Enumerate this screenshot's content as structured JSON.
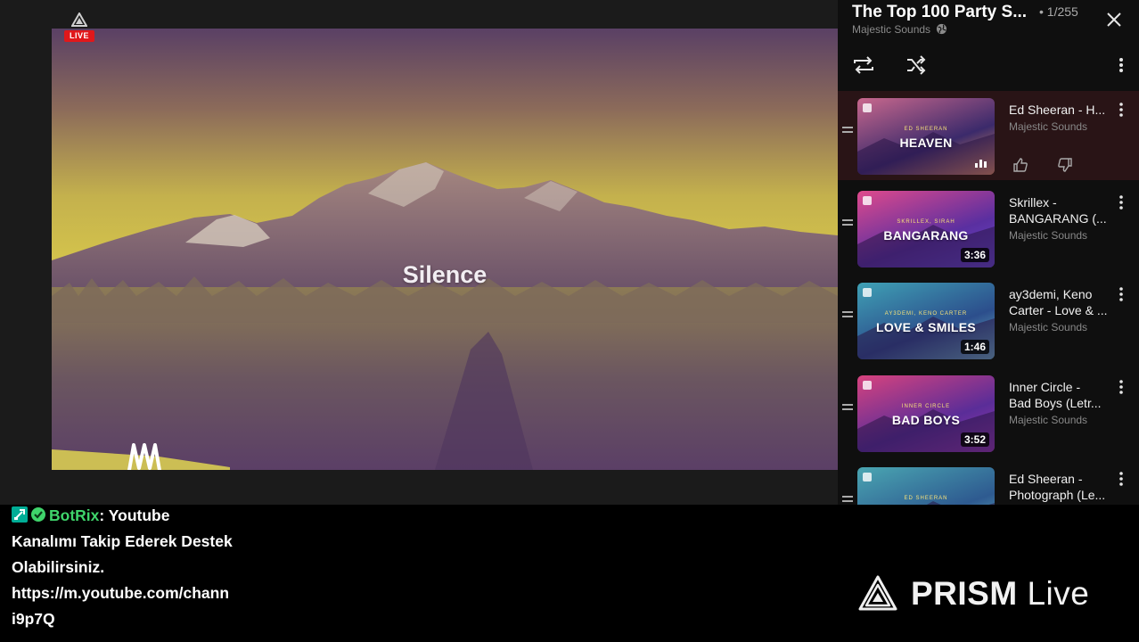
{
  "video": {
    "title": "Silence",
    "live_label": "LIVE"
  },
  "playlist": {
    "title": "The Top 100 Party S...",
    "position": "• 1/255",
    "channel": "Majestic Sounds",
    "items": [
      {
        "title_line1": "Ed Sheeran - H...",
        "title_line2": "",
        "channel": "Majestic Sounds",
        "thumb_title": "HEAVEN",
        "thumb_sub": "ED SHEERAN",
        "duration": "",
        "playing": true,
        "thumb_colors": [
          "#c9688d",
          "#3b2a6b",
          "#f29b57"
        ]
      },
      {
        "title_line1": "Skrillex -",
        "title_line2": "BANGARANG (...",
        "channel": "Majestic Sounds",
        "thumb_title": "BANGARANG",
        "thumb_sub": "SKRILLEX, SIRAH",
        "duration": "3:36",
        "playing": false,
        "thumb_colors": [
          "#e04a8c",
          "#5a2fa0",
          "#6b4ad0"
        ]
      },
      {
        "title_line1": "ay3demi, Keno",
        "title_line2": "Carter - Love & ...",
        "channel": "Majestic Sounds",
        "thumb_title": "LOVE & SMILES",
        "thumb_sub": "AY3DEMI, KENO CARTER",
        "duration": "1:46",
        "playing": false,
        "thumb_colors": [
          "#3fa1b5",
          "#2c4e8c",
          "#71c0c4"
        ]
      },
      {
        "title_line1": "Inner Circle -",
        "title_line2": "Bad Boys (Letr...",
        "channel": "Majestic Sounds",
        "thumb_title": "BAD BOYS",
        "thumb_sub": "INNER CIRCLE",
        "duration": "3:52",
        "playing": false,
        "thumb_colors": [
          "#d8437e",
          "#5a2d98",
          "#a03ab0"
        ]
      },
      {
        "title_line1": "Ed Sheeran -",
        "title_line2": "Photograph (Le...",
        "channel": "",
        "thumb_title": "",
        "thumb_sub": "ED SHEERAN",
        "duration": "",
        "playing": false,
        "thumb_colors": [
          "#4aa6b2",
          "#2e5a90",
          "#6ac4c6"
        ]
      }
    ]
  },
  "chat": {
    "username": "BotRix",
    "separator": ":",
    "message": "Youtube Kanalımı Takip Ederek Destek Olabilirsiniz. https://m.youtube.com/chann i9p7Q",
    "lines": [
      " Youtube",
      "Kanalımı Takip Ederek Destek",
      "Olabilirsiniz.",
      "https://m.youtube.com/chann",
      "i9p7Q"
    ],
    "colors": {
      "username": "#3fd46b",
      "text": "#ffffff"
    }
  },
  "branding": {
    "prism_bold": "PRISM",
    "prism_light": " Live"
  },
  "icons": {
    "live_triangle": "prism-triangle-icon",
    "globe": "globe-icon",
    "close": "close-icon",
    "loop": "loop-icon",
    "shuffle": "shuffle-icon",
    "menu": "more-vert-icon",
    "like": "thumbs-up-icon",
    "dislike": "thumbs-down-icon",
    "channel_logo": "majestic-sounds-logo-icon"
  },
  "colors": {
    "live_red": "#e0181b",
    "panel_bg": "#0f0f0f",
    "active_row": "#291416",
    "video_tint_top": "#6a4f72",
    "video_tint_sky": "#c6b64d"
  }
}
